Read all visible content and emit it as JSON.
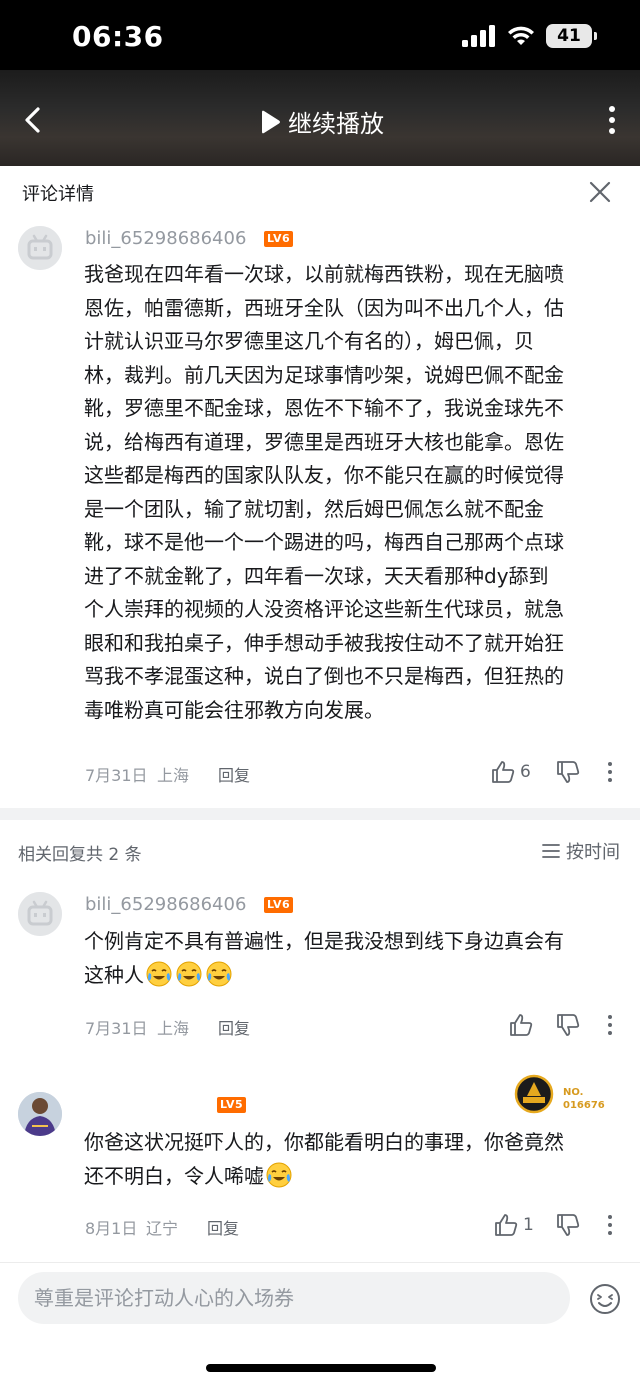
{
  "status_bar": {
    "time": "06:36",
    "battery": "41"
  },
  "video_header": {
    "play_label": "继续播放"
  },
  "sheet": {
    "title": "评论详情"
  },
  "main_comment": {
    "username": "bili_65298686406",
    "level": "LV6",
    "lines": [
      "我爸现在四年看一次球，以前就梅西铁粉，现在无脑喷",
      "恩佐，帕雷德斯，西班牙全队（因为叫不出几个人，估",
      "计就认识亚马尔罗德里这几个有名的），姆巴佩，贝",
      "林，裁判。前几天因为足球事情吵架，说姆巴佩不配金",
      "靴，罗德里不配金球，恩佐不下输不了，我说金球先不",
      "说，给梅西有道理，罗德里是西班牙大核也能拿。恩佐",
      "这些都是梅西的国家队队友，你不能只在赢的时候觉得",
      "是一个团队，输了就切割，然后姆巴佩怎么就不配金",
      "靴，球不是他一个一个踢进的吗，梅西自己那两个点球",
      "进了不就金靴了，四年看一次球，天天看那种dy舔到",
      "个人崇拜的视频的人没资格评论这些新生代球员，就急",
      "眼和和我拍桌子，伸手想动手被我按住动不了就开始狂",
      "骂我不孝混蛋这种，说白了倒也不只是梅西，但狂热的",
      "毒唯粉真可能会往邪教方向发展。"
    ],
    "date": "7月31日",
    "location": "上海",
    "reply_label": "回复",
    "like_count": "6"
  },
  "replies_header": {
    "count_text": "相关回复共 2 条",
    "sort_label": "按时间"
  },
  "replies": [
    {
      "username": "bili_65298686406",
      "level": "LV6",
      "lines": [
        "个例肯定不具有普遍性，但是我没想到线下身边真会有",
        "这种人"
      ],
      "date": "7月31日",
      "location": "上海",
      "reply_label": "回复",
      "like_count": ""
    },
    {
      "username": "",
      "level": "LV5",
      "badge_number": "NO.\n016676",
      "lines": [
        "你爸这状况挺吓人的，你都能看明白的事理，你爸竟然",
        "还不明白，令人唏嘘"
      ],
      "date": "8月1日",
      "location": "辽宁",
      "reply_label": "回复",
      "like_count": "1"
    }
  ],
  "input": {
    "placeholder": "尊重是评论打动人心的入场券"
  },
  "colors": {
    "level_orange": "#ff6c00",
    "meta_gray": "#9499a0",
    "text": "#18191c"
  }
}
